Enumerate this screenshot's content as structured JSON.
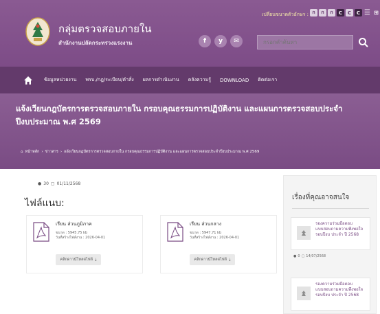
{
  "header": {
    "site_title": "กลุ่มตรวจสอบภายใน",
    "site_subtitle": "สำนักงานปลัดกระทรวงแรงงาน",
    "fontsize_label": "เปลี่ยนขนาดตัวอักษร :",
    "fontsize_buttons": [
      "ก",
      "ก",
      "ก",
      "C",
      "C",
      "C"
    ],
    "social": [
      "f",
      "y",
      "✉"
    ],
    "search_placeholder": "กรอกคำค้นหา"
  },
  "nav": {
    "items": [
      "ข้อมูลหน่วยงาน",
      "พรบ./กฎ/ระเบียบ/คำสั่ง",
      "ผลการดำเนินงาน",
      "คลังความรู้",
      "DOWNLOAD",
      "ติดต่อเรา"
    ]
  },
  "banner": {
    "title": "แจ้งเวียนกฎบัตรการตรวจสอบภายใน กรอบคุณธรรมการปฏิบัติงาน และแผนการตรวจสอบประจำปีงบประมาณ พ.ศ 2569",
    "breadcrumb": [
      "หน้าหลัก",
      "ข่าวสาร",
      "แจ้งเวียนกฎบัตรการตรวจสอบภายใน กรอบคุณธรรมการปฏิบัติงาน และแผนการตรวจสอบประจำปีงบประมาณ พ.ศ 2569"
    ]
  },
  "main": {
    "views": "30",
    "date": "01/11/2568",
    "attachments_title": "ไฟล์แนบ:",
    "files": [
      {
        "name": "เรียน ส่วนภูมิภาค",
        "size": "ขนาด : 5945.75 kb",
        "date": "วันที่สร้างไฟล์งาน : 2026-04-01",
        "download": "คลิกดาวน์โหลดไฟล์"
      },
      {
        "name": "เรียน ส่วนกลาง",
        "size": "ขนาด : 5947.71 kb",
        "date": "วันที่สร้างไฟล์งาน : 2026-04-01",
        "download": "คลิกดาวน์โหลดไฟล์"
      }
    ]
  },
  "sidebar": {
    "title": "เรื่องที่คุณอาจสนใจ",
    "items": [
      {
        "text": "รองความร่วมมือตอบแบบสอบถามความพึงพอใจรอบปีงบ ประจำ ปี 2568",
        "views": "0",
        "date": "14/07/2568"
      },
      {
        "text": "รองความร่วมมือตอบแบบสอบถามความพึงพอใจรอบปีงบ ประจำ ปี 2568",
        "views": "",
        "date": ""
      }
    ]
  },
  "colors": {
    "primary": "#7d4c87",
    "nav": "#633a6b",
    "accent": "#a983b0"
  }
}
